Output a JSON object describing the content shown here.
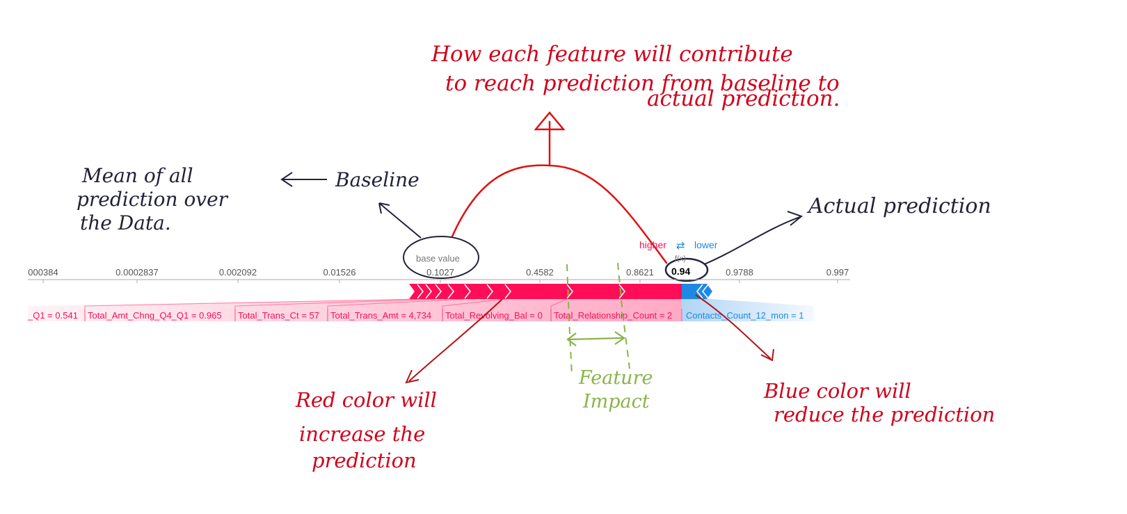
{
  "force_plot": {
    "legend": {
      "higher": "higher",
      "arrow": "⇄",
      "lower": "lower"
    },
    "base_value_label": "base value",
    "fx_label": "f(x)",
    "fx_value": "0.94",
    "axis_ticks": [
      "000384",
      "0.0002837",
      "0.002092",
      "0.01526",
      "0.1027",
      "0.4582",
      "0.8621",
      "0.9788",
      "0.997"
    ],
    "features_increase": [
      "_Q1 = 0.541",
      "Total_Amt_Chng_Q4_Q1 = 0.965",
      "Total_Trans_Ct = 57",
      "Total_Trans_Amt = 4,734",
      "Total_Revolving_Bal = 0",
      "Total_Relationship_Count = 2"
    ],
    "features_decrease": [
      "Contacts_Count_12_mon = 1"
    ],
    "colors": {
      "increase": "#ff0d57",
      "decrease": "#1e88e5",
      "axis": "#888888",
      "label_text": "#555555"
    }
  },
  "annotations": {
    "top": [
      "How each feature will contribute",
      "to reach prediction from baseline to",
      "actual prediction."
    ],
    "baseline": [
      "Mean of all",
      "prediction over",
      "the Data."
    ],
    "baseline_arrow_label": "Baseline",
    "actual_prediction": "Actual prediction",
    "red_note": [
      "Red color will",
      "increase the",
      "prediction"
    ],
    "blue_note": [
      "Blue color will",
      "reduce the prediction"
    ],
    "feature_impact": [
      "Feature",
      "Impact"
    ],
    "colors": {
      "red_ink": "#d0021b",
      "dark_ink": "#22223a",
      "green_ink": "#8ab34a"
    }
  }
}
